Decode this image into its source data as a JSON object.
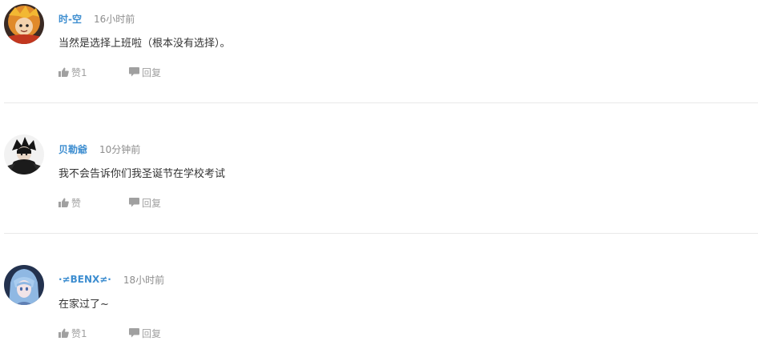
{
  "comments": [
    {
      "username": "时-空",
      "time": "16小时前",
      "content": "当然是选择上班啦（根本没有选择）。",
      "like_label": "赞1",
      "reply_label": "回复",
      "avatar": "avatar-anime-orange"
    },
    {
      "username": "贝勒爺",
      "time": "10分钟前",
      "content": "我不会告诉你们我圣诞节在学校考试",
      "like_label": "赞",
      "reply_label": "回复",
      "avatar": "avatar-anime-dark"
    },
    {
      "username": "·≠BENX≠·",
      "time": "18小时前",
      "content": "在家过了~",
      "like_label": "赞1",
      "reply_label": "回复",
      "avatar": "avatar-anime-blue"
    }
  ],
  "icons": {
    "like": "thumbs-up-icon",
    "reply": "speech-bubble-icon"
  },
  "colors": {
    "username": "#3e8ed0",
    "time": "#8d8d8d",
    "text": "#333333",
    "action": "#a0a0a0",
    "divider": "#e9e9e9"
  }
}
